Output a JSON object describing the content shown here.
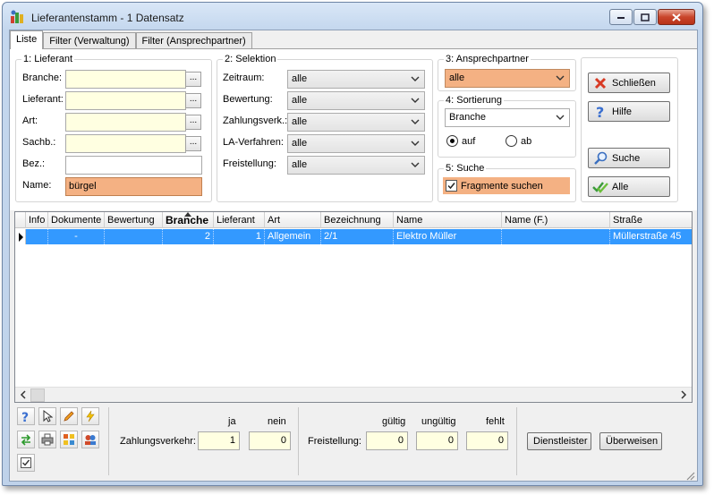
{
  "window": {
    "title": "Lieferantenstamm - 1 Datensatz"
  },
  "tabs": [
    "Liste",
    "Filter (Verwaltung)",
    "Filter (Ansprechpartner)"
  ],
  "lieferant_group": {
    "title": "1: Lieferant",
    "fields": {
      "branche_label": "Branche:",
      "lieferant_label": "Lieferant:",
      "art_label": "Art:",
      "sachb_label": "Sachb.:",
      "bez_label": "Bez.:",
      "name_label": "Name:",
      "name_value": "bürgel",
      "browse": "..."
    }
  },
  "selektion_group": {
    "title": "2: Selektion",
    "zeitraum_label": "Zeitraum:",
    "zeitraum_value": "alle",
    "bewertung_label": "Bewertung:",
    "bewertung_value": "alle",
    "zahlungsverk_label": "Zahlungsverk.:",
    "zahlungsverk_value": "alle",
    "la_verfahren_label": "LA-Verfahren:",
    "la_verfahren_value": "alle",
    "freistellung_label": "Freistellung:",
    "freistellung_value": "alle"
  },
  "ansprechpartner_group": {
    "title": "3: Ansprechpartner",
    "value": "alle"
  },
  "sortierung_group": {
    "title": "4: Sortierung",
    "value": "Branche",
    "auf_label": "auf",
    "ab_label": "ab",
    "selected": "auf"
  },
  "suche_group": {
    "title": "5: Suche",
    "fragmente_label": "Fragmente suchen",
    "fragmente_checked": true
  },
  "buttons": {
    "schliessen": "Schließen",
    "hilfe": "Hilfe",
    "suche": "Suche",
    "alle": "Alle",
    "dienstleister": "Dienstleister",
    "ueberweisen": "Überweisen"
  },
  "grid": {
    "columns": [
      "Info",
      "Dokumente",
      "Bewertung",
      "Branche",
      "Lieferant",
      "Art",
      "Bezeichnung",
      "Name",
      "Name (F.)",
      "Straße"
    ],
    "sorted_column": "Branche",
    "rows": [
      {
        "info": "",
        "dokumente": "-",
        "bewertung": "",
        "branche": "2",
        "lieferant": "1",
        "art": "Allgemein",
        "bezeichnung": "2/1",
        "name": "Elektro Müller",
        "name_f": "",
        "strasse": "Müllerstraße 45"
      }
    ]
  },
  "summary": {
    "zahlungsverkehr_label": "Zahlungsverkehr:",
    "ja_label": "ja",
    "nein_label": "nein",
    "ja_value": "1",
    "nein_value": "0",
    "freistellung_label": "Freistellung:",
    "gueltig_label": "gültig",
    "ungueltig_label": "ungültig",
    "fehlt_label": "fehlt",
    "gueltig_value": "0",
    "ungueltig_value": "0",
    "fehlt_value": "0"
  },
  "colors": {
    "accent_orange": "#f4b183",
    "selection_blue": "#3399ff",
    "input_yellow": "#ffffe1"
  }
}
